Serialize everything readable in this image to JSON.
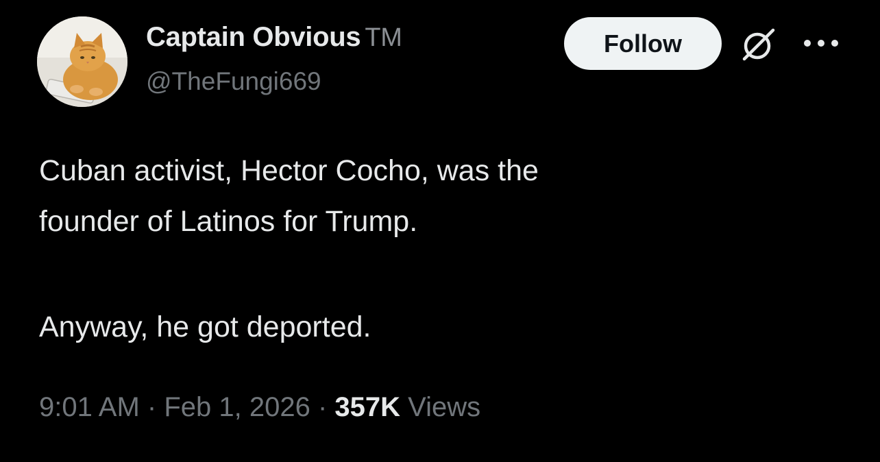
{
  "author": {
    "display_name": "Captain Obvious",
    "badge": "TM",
    "handle": "@TheFungi669",
    "avatar_icon": "orange-cat-avatar"
  },
  "actions": {
    "follow_label": "Follow",
    "grok_icon": "grok-icon",
    "more_icon": "more-icon"
  },
  "tweet": {
    "line1": "Cuban activist, Hector Cocho, was the",
    "line2": "founder of Latinos for Trump.",
    "line3": "Anyway, he got deported."
  },
  "meta": {
    "time": "9:01 AM",
    "separator": "·",
    "date": "Feb 1, 2026",
    "views_count": "357K",
    "views_label": "Views"
  },
  "colors": {
    "background": "#000000",
    "primary_text": "#e7e9ea",
    "secondary_text": "#71767b",
    "follow_bg": "#eff3f4"
  }
}
